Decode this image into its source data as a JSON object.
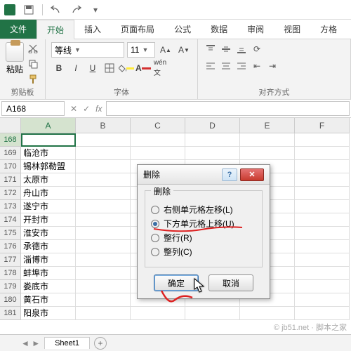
{
  "tabs": {
    "file": "文件",
    "home": "开始",
    "insert": "插入",
    "layout": "页面布局",
    "formulas": "公式",
    "data": "数据",
    "review": "审阅",
    "view": "视图",
    "square": "方格"
  },
  "ribbon": {
    "clipboard": {
      "paste": "粘贴",
      "label": "剪贴板"
    },
    "font": {
      "label": "字体",
      "name": "等线",
      "size": "11",
      "bold": "B",
      "italic": "I",
      "underline": "U"
    },
    "align": {
      "label": "对齐方式"
    }
  },
  "namebox": "A168",
  "fx_label": "fx",
  "columns": [
    "A",
    "B",
    "C",
    "D",
    "E",
    "F"
  ],
  "rows": [
    {
      "n": "168",
      "a": ""
    },
    {
      "n": "169",
      "a": "临沧市"
    },
    {
      "n": "170",
      "a": "锡林郭勒盟"
    },
    {
      "n": "171",
      "a": "太原市"
    },
    {
      "n": "172",
      "a": "舟山市"
    },
    {
      "n": "173",
      "a": "遂宁市"
    },
    {
      "n": "174",
      "a": "开封市"
    },
    {
      "n": "175",
      "a": "淮安市"
    },
    {
      "n": "176",
      "a": "承德市"
    },
    {
      "n": "177",
      "a": "淄博市"
    },
    {
      "n": "178",
      "a": "蚌埠市"
    },
    {
      "n": "179",
      "a": "娄底市"
    },
    {
      "n": "180",
      "a": "黄石市"
    },
    {
      "n": "181",
      "a": "阳泉市"
    }
  ],
  "dialog": {
    "title": "删除",
    "legend": "删除",
    "opt_shift_left": "右侧单元格左移(L)",
    "opt_shift_up": "下方单元格上移(U)",
    "opt_row": "整行(R)",
    "opt_col": "整列(C)",
    "ok": "确定",
    "cancel": "取消"
  },
  "sheet": {
    "name": "Sheet1"
  },
  "watermark": "© jb51.net · 脚本之家"
}
